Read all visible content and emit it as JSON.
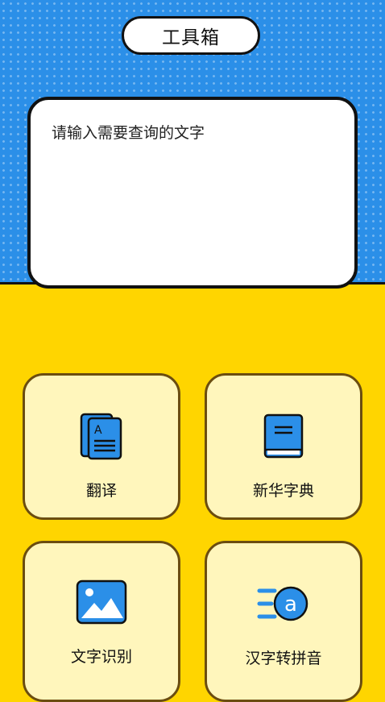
{
  "header": {
    "title": "工具箱"
  },
  "search": {
    "placeholder": "请输入需要查询的文字"
  },
  "tools": [
    {
      "label": "翻译",
      "icon": "translate-document-icon"
    },
    {
      "label": "新华字典",
      "icon": "dictionary-book-icon"
    },
    {
      "label": "文字识别",
      "icon": "image-ocr-icon"
    },
    {
      "label": "汉字转拼音",
      "icon": "pinyin-convert-icon"
    }
  ],
  "colors": {
    "top_background": "#2B8FE8",
    "bottom_background": "#FFD500",
    "tile_background": "#FFF6BC",
    "icon_blue": "#2B8FE8"
  }
}
